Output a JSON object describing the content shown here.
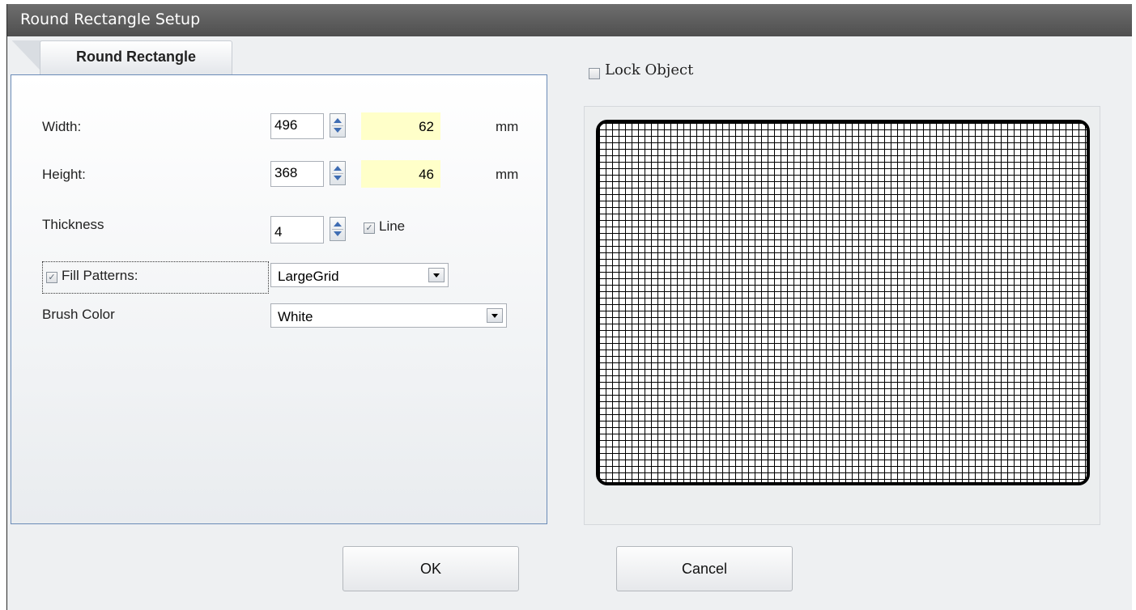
{
  "window": {
    "title": "Round Rectangle Setup"
  },
  "tab": {
    "label": "Round Rectangle"
  },
  "form": {
    "width_label": "Width:",
    "width_value": "496",
    "width_mm": "62",
    "height_label": "Height:",
    "height_value": "368",
    "height_mm": "46",
    "unit": "mm",
    "thickness_label": "Thickness",
    "thickness_value": "4",
    "line_label": "Line",
    "line_checked": true,
    "fill_label": "Fill Patterns:",
    "fill_checked": true,
    "fill_value": "LargeGrid",
    "brush_label": "Brush Color",
    "brush_value": "White"
  },
  "preview": {
    "lock_label": "Lock Object",
    "lock_checked": false,
    "pattern": "LargeGrid"
  },
  "buttons": {
    "ok": "OK",
    "cancel": "Cancel"
  },
  "colors": {
    "highlight_field": "#ffffc9",
    "panel_border": "#6a8bb7",
    "titlebar": "#5a5a5a"
  }
}
